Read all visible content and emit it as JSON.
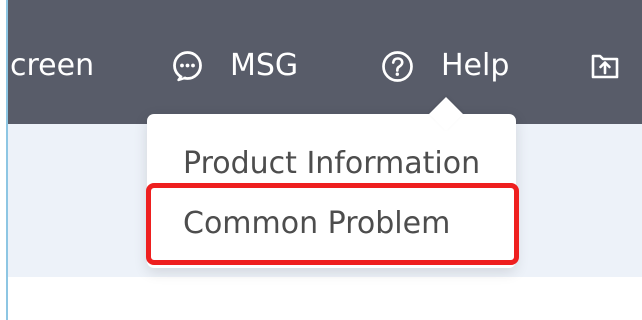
{
  "topbar": {
    "screen_label": "creen",
    "msg_label": "MSG",
    "help_label": "Help"
  },
  "help_menu": {
    "items": [
      {
        "label": "Product Information"
      },
      {
        "label": "Common Problem"
      }
    ]
  },
  "colors": {
    "topbar": "#585c69",
    "content_band": "#edf2f9",
    "highlight": "#ee1f1f",
    "menu_text": "#4d4d4d"
  },
  "icons": {
    "msg": "chat-bubble-icon",
    "help": "question-circle-icon",
    "upload": "upload-tray-icon"
  }
}
